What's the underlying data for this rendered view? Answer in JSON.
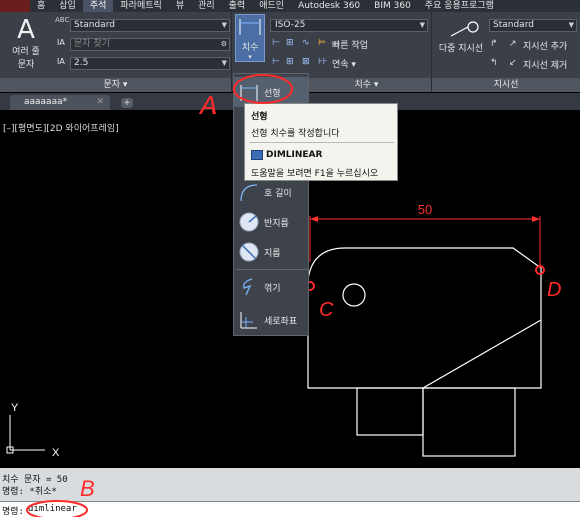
{
  "menu": {
    "items": [
      "홈",
      "삽입",
      "주석",
      "파라메트릭",
      "뷰",
      "관리",
      "출력",
      "애드인",
      "Autodesk 360",
      "BIM 360",
      "주요 응용프로그램"
    ],
    "active_index": 2
  },
  "ribbon": {
    "text_panel": {
      "multiline_label": "여러 줄",
      "multiline_label2": "문자",
      "style_value": "Standard",
      "find_placeholder": "문자 찾기",
      "height_value": "2.5",
      "title": "문자 ▾"
    },
    "dim_panel": {
      "big_button_label": "치수",
      "style_value": "ISO-25",
      "quick_label": "빠른 작업",
      "continue_label": "연속 ▾",
      "title": "치수 ▾"
    },
    "leader_panel": {
      "multileader_label": "다중 지시선",
      "style_value": "Standard",
      "add_label": "지시선 추가",
      "remove_label": "지시선 제거",
      "title": "지시선"
    }
  },
  "tabs": {
    "doc_name": "aaaaaaa*",
    "close": "✕",
    "new": "+"
  },
  "viewport": {
    "label": "[–][평면도][2D 와이어프레임]"
  },
  "dropdown": {
    "items": [
      "선형",
      "호 길이",
      "반지름",
      "지름",
      "꺾기",
      "세로좌표"
    ]
  },
  "tooltip": {
    "title": "선형",
    "desc": "선형 치수를 작성합니다",
    "command": "DIMLINEAR",
    "help": "도움말을 보려면 F1을 누르십시오"
  },
  "drawing": {
    "dimension_text": "50",
    "ucs_x": "X",
    "ucs_y": "Y"
  },
  "annotations": {
    "a": "A",
    "b": "B",
    "c": "C",
    "d": "D",
    "color": "#ff2a2a"
  },
  "command": {
    "history_lines": [
      "치수 문자 = 50",
      "명령: *취소*"
    ],
    "prompt": "명령:",
    "input": "dimlinear"
  }
}
